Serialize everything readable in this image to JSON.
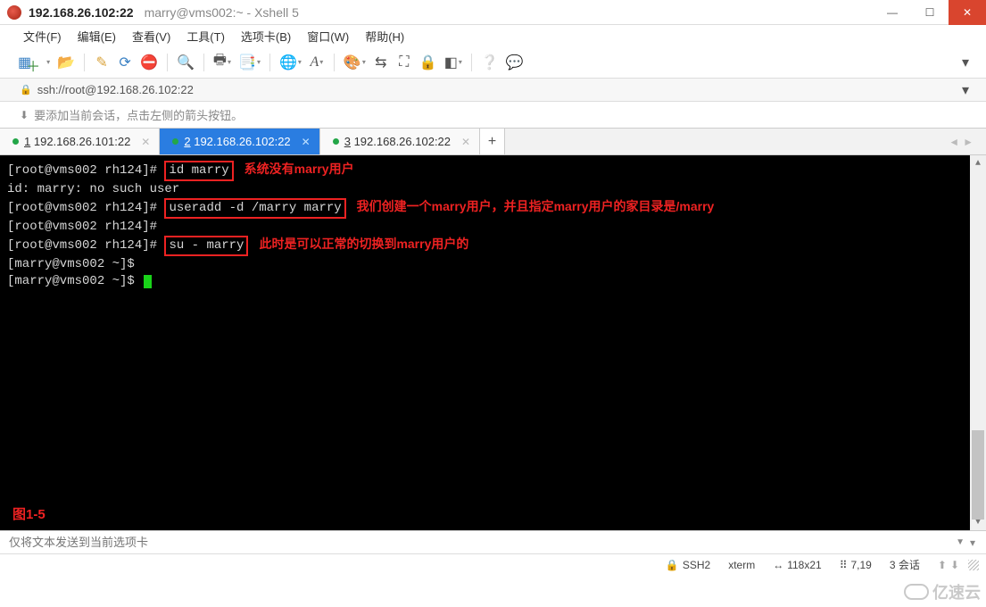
{
  "titlebar": {
    "strong": "192.168.26.102:22",
    "sub": "marry@vms002:~ - Xshell 5"
  },
  "menu": {
    "items": [
      "文件(F)",
      "编辑(E)",
      "查看(V)",
      "工具(T)",
      "选项卡(B)",
      "窗口(W)",
      "帮助(H)"
    ]
  },
  "toolbar": {
    "items": [
      "new",
      "open",
      "|",
      "edit",
      "reconnect",
      "disconnect",
      "|",
      "find",
      "|",
      "printer",
      "copy",
      "|",
      "globe",
      "font",
      "|",
      "color",
      "arrows",
      "fullscreen",
      "lock",
      "sidebar",
      "|",
      "help",
      "speech"
    ]
  },
  "address": {
    "url": "ssh://root@192.168.26.102:22"
  },
  "hint": {
    "text": "要添加当前会话，点击左侧的箭头按钮。"
  },
  "tabs": {
    "items": [
      {
        "num": "1",
        "label": "192.168.26.101:22",
        "active": false
      },
      {
        "num": "2",
        "label": "192.168.26.102:22",
        "active": true
      },
      {
        "num": "3",
        "label": "192.168.26.102:22",
        "active": false
      }
    ]
  },
  "term": {
    "p1": "[root@vms002 rh124]# ",
    "cmd1": "id marry",
    "a1": "系统没有marry用户",
    "l2": "id: marry: no such user",
    "p3": "[root@vms002 rh124]# ",
    "cmd3": "useradd -d /marry marry",
    "a3": "我们创建一个marry用户，并且指定marry用户的家目录是/marry",
    "p4": "[root@vms002 rh124]#",
    "p5": "[root@vms002 rh124]# ",
    "cmd5": "su - marry",
    "a5": "此时是可以正常的切换到marry用户的",
    "p6": "[marry@vms002 ~]$",
    "p7": "[marry@vms002 ~]$ ",
    "fig": "图1-5"
  },
  "bottom": {
    "placeholder": "仅将文本发送到当前选项卡"
  },
  "status": {
    "ssh": "SSH2",
    "termtype": "xterm",
    "size": "118x21",
    "pos": "7,19",
    "sessions": "3 会话"
  },
  "watermark": "亿速云"
}
